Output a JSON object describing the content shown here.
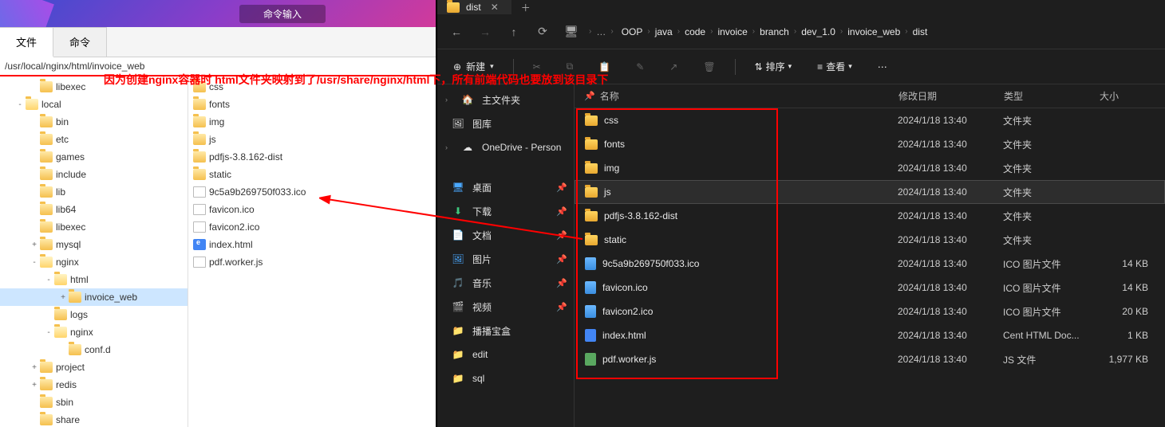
{
  "left": {
    "header_label": "命令输入",
    "tabs": [
      "文件",
      "命令"
    ],
    "active_tab": 0,
    "path": "/usr/local/nginx/html/invoice_web",
    "tree": [
      {
        "indent": 2,
        "exp": "",
        "label": "libexec"
      },
      {
        "indent": 1,
        "exp": "-",
        "label": "local",
        "open": true
      },
      {
        "indent": 2,
        "exp": "",
        "label": "bin"
      },
      {
        "indent": 2,
        "exp": "",
        "label": "etc"
      },
      {
        "indent": 2,
        "exp": "",
        "label": "games"
      },
      {
        "indent": 2,
        "exp": "",
        "label": "include"
      },
      {
        "indent": 2,
        "exp": "",
        "label": "lib"
      },
      {
        "indent": 2,
        "exp": "",
        "label": "lib64"
      },
      {
        "indent": 2,
        "exp": "",
        "label": "libexec"
      },
      {
        "indent": 2,
        "exp": "+",
        "label": "mysql"
      },
      {
        "indent": 2,
        "exp": "-",
        "label": "nginx",
        "open": true
      },
      {
        "indent": 3,
        "exp": "-",
        "label": "html",
        "open": true
      },
      {
        "indent": 4,
        "exp": "+",
        "label": "invoice_web",
        "selected": true
      },
      {
        "indent": 3,
        "exp": "",
        "label": "logs"
      },
      {
        "indent": 3,
        "exp": "-",
        "label": "nginx",
        "open": true
      },
      {
        "indent": 4,
        "exp": "",
        "label": "conf.d"
      },
      {
        "indent": 2,
        "exp": "+",
        "label": "project"
      },
      {
        "indent": 2,
        "exp": "+",
        "label": "redis"
      },
      {
        "indent": 2,
        "exp": "",
        "label": "sbin"
      },
      {
        "indent": 2,
        "exp": "",
        "label": "share"
      }
    ],
    "files": [
      {
        "type": "folder",
        "name": "css"
      },
      {
        "type": "folder",
        "name": "fonts"
      },
      {
        "type": "folder",
        "name": "img"
      },
      {
        "type": "folder",
        "name": "js"
      },
      {
        "type": "folder",
        "name": "pdfjs-3.8.162-dist"
      },
      {
        "type": "folder",
        "name": "static"
      },
      {
        "type": "file",
        "name": "9c5a9b269750f033.ico"
      },
      {
        "type": "file",
        "name": "favicon.ico"
      },
      {
        "type": "file",
        "name": "favicon2.ico"
      },
      {
        "type": "html",
        "name": "index.html"
      },
      {
        "type": "file",
        "name": "pdf.worker.js"
      }
    ]
  },
  "annotation": "因为创建nginx容器时 html文件夹映射到了/usr/share/nginx/html下，所有前端代码也要放到该目录下",
  "right": {
    "tab_title": "dist",
    "breadcrumbs": [
      "OOP",
      "java",
      "code",
      "invoice",
      "branch",
      "dev_1.0",
      "invoice_web",
      "dist"
    ],
    "toolbar": {
      "new": "新建",
      "sort": "排序",
      "view": "查看"
    },
    "sidebar": [
      {
        "group": true,
        "icon": "home",
        "label": "主文件夹"
      },
      {
        "icon": "gallery",
        "label": "图库"
      },
      {
        "group": true,
        "icon": "onedrive",
        "label": "OneDrive - Person"
      },
      {
        "spacer": true
      },
      {
        "icon": "desktop",
        "label": "桌面",
        "pinned": true
      },
      {
        "icon": "download",
        "label": "下载",
        "pinned": true
      },
      {
        "icon": "document",
        "label": "文档",
        "pinned": true
      },
      {
        "icon": "picture",
        "label": "图片",
        "pinned": true
      },
      {
        "icon": "music",
        "label": "音乐",
        "pinned": true
      },
      {
        "icon": "video",
        "label": "视频",
        "pinned": true
      },
      {
        "icon": "folder",
        "label": "播播宝盒"
      },
      {
        "icon": "folder",
        "label": "edit"
      },
      {
        "icon": "folder",
        "label": "sql"
      }
    ],
    "columns": {
      "name": "名称",
      "date": "修改日期",
      "type": "类型",
      "size": "大小"
    },
    "rows": [
      {
        "icon": "folder",
        "name": "css",
        "date": "2024/1/18 13:40",
        "type": "文件夹",
        "size": ""
      },
      {
        "icon": "folder",
        "name": "fonts",
        "date": "2024/1/18 13:40",
        "type": "文件夹",
        "size": ""
      },
      {
        "icon": "folder",
        "name": "img",
        "date": "2024/1/18 13:40",
        "type": "文件夹",
        "size": ""
      },
      {
        "icon": "folder",
        "name": "js",
        "date": "2024/1/18 13:40",
        "type": "文件夹",
        "size": "",
        "selected": true
      },
      {
        "icon": "folder",
        "name": "pdfjs-3.8.162-dist",
        "date": "2024/1/18 13:40",
        "type": "文件夹",
        "size": ""
      },
      {
        "icon": "folder",
        "name": "static",
        "date": "2024/1/18 13:40",
        "type": "文件夹",
        "size": ""
      },
      {
        "icon": "ico",
        "name": "9c5a9b269750f033.ico",
        "date": "2024/1/18 13:40",
        "type": "ICO 图片文件",
        "size": "14 KB"
      },
      {
        "icon": "ico",
        "name": "favicon.ico",
        "date": "2024/1/18 13:40",
        "type": "ICO 图片文件",
        "size": "14 KB"
      },
      {
        "icon": "ico",
        "name": "favicon2.ico",
        "date": "2024/1/18 13:40",
        "type": "ICO 图片文件",
        "size": "20 KB"
      },
      {
        "icon": "html",
        "name": "index.html",
        "date": "2024/1/18 13:40",
        "type": "Cent HTML Doc...",
        "size": "1 KB"
      },
      {
        "icon": "js",
        "name": "pdf.worker.js",
        "date": "2024/1/18 13:40",
        "type": "JS 文件",
        "size": "1,977 KB"
      }
    ]
  }
}
